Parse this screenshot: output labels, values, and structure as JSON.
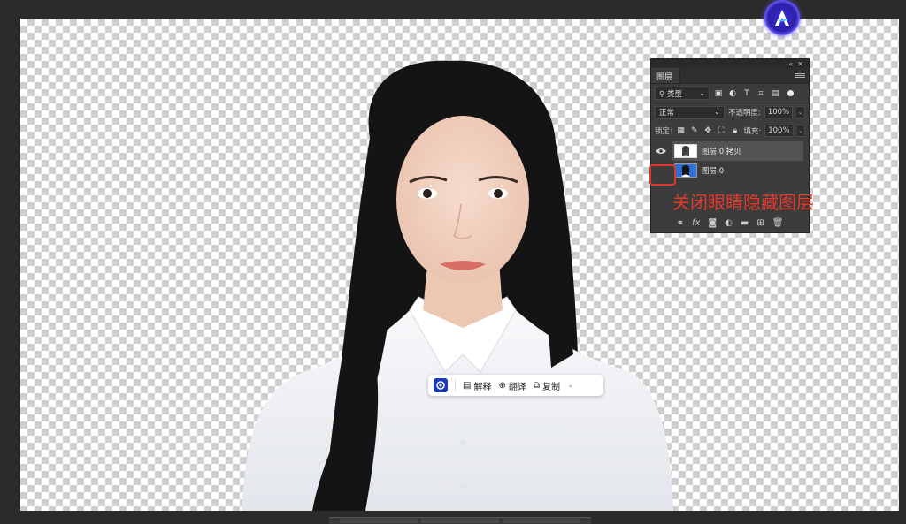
{
  "layers_panel": {
    "tab_label": "图层",
    "filter_kind": "类型",
    "blend_mode": "正常",
    "opacity_label": "不透明度:",
    "opacity_value": "100%",
    "lock_label": "锁定:",
    "fill_label": "填充:",
    "fill_value": "100%",
    "layers": [
      {
        "name": "图层 0 拷贝",
        "visible": true,
        "selected": true
      },
      {
        "name": "图层 0",
        "visible": false,
        "selected": false
      }
    ]
  },
  "annotation": {
    "text": "关闭眼睛隐藏图层",
    "color": "#e4392c"
  },
  "float_toolbar": {
    "explain_label": "解释",
    "translate_label": "翻译",
    "copy_label": "复制"
  },
  "colors": {
    "app_bg": "#2b2b2b",
    "panel_bg": "#3c3c3c",
    "highlight": "#e1372b"
  }
}
